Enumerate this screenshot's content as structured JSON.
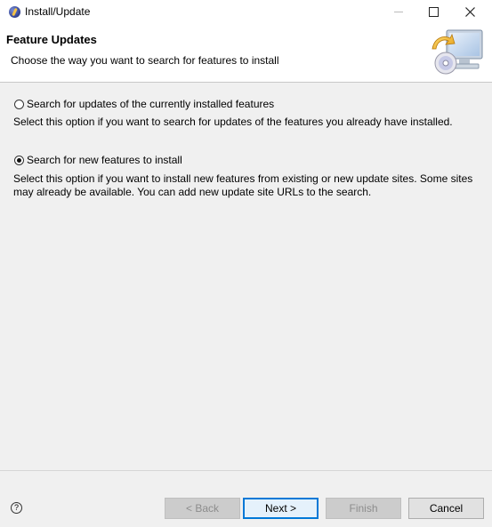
{
  "window": {
    "title": "Install/Update"
  },
  "header": {
    "title": "Feature Updates",
    "description": "Choose the way you want to search for features to install"
  },
  "options": [
    {
      "label": "Search for updates of the currently installed features",
      "description": "Select this option if you want to search for updates of the features you already have installed.",
      "selected": false
    },
    {
      "label": "Search for new features to install",
      "description": "Select this option if you want to install new features from existing or new update sites. Some sites may already be available. You can add new update site URLs to the search.",
      "selected": true
    }
  ],
  "buttons": {
    "back": "< Back",
    "next": "Next >",
    "finish": "Finish",
    "cancel": "Cancel",
    "help": "?"
  }
}
